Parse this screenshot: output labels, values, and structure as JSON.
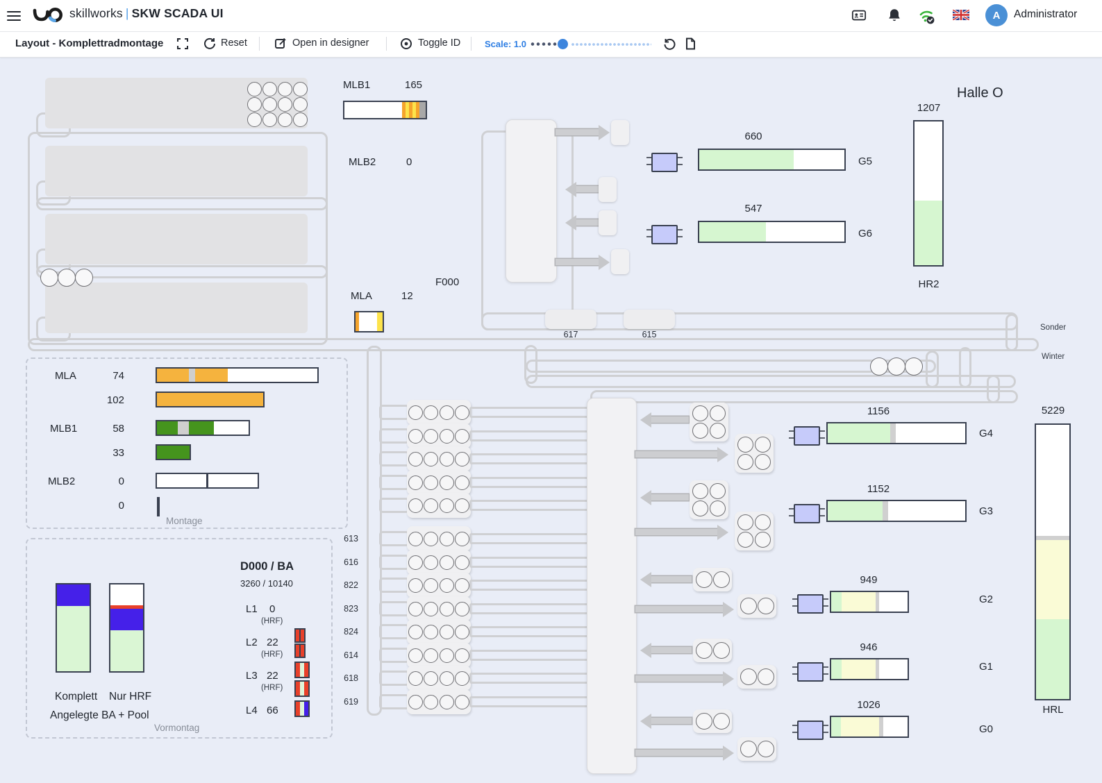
{
  "header": {
    "brand": "skillworks",
    "sep": "|",
    "app": "SKW SCADA UI",
    "user": "Administrator",
    "avatar": "A"
  },
  "toolbar": {
    "layout": "Layout - Komplettradmontage",
    "reset": "Reset",
    "designer": "Open in designer",
    "toggleid": "Toggle ID",
    "scale": "Scale: 1.0"
  },
  "colors": {
    "accent_blue": "#2e7ee3",
    "bar_border": "#394050",
    "fill_green": "#d6f6d0",
    "fill_yellow": "#fafbd6",
    "fill_orange": "#f5b33e",
    "fill_dkgreen": "#45941d",
    "fill_purple": "#4520e9",
    "fill_red": "#e8402a",
    "chip_blue": "#c6cbfa",
    "canvas_bg": "#e9edf7"
  },
  "canvas": {
    "halle": "Halle O",
    "f000": "F000",
    "sonder": "Sonder",
    "winter": "Winter",
    "st617": "617",
    "st615": "615",
    "mlb1": {
      "label": "MLB1",
      "value": "165",
      "segs": [
        [
          71,
          "#ffffff"
        ],
        [
          4.3,
          "#f5a42c"
        ],
        [
          4.3,
          "#fde34b"
        ],
        [
          4.3,
          "#f5a42c"
        ],
        [
          4.3,
          "#fde34b"
        ],
        [
          4.3,
          "#f5a42c"
        ],
        [
          7.5,
          "#a8a8a8"
        ]
      ]
    },
    "mlb2": {
      "label": "MLB2",
      "value": "0"
    },
    "mla": {
      "label": "MLA",
      "value": "12",
      "segs": [
        [
          12,
          "#f5a42c"
        ],
        [
          68,
          "#ffffff"
        ],
        [
          20,
          "#fde34b"
        ]
      ]
    },
    "g5": {
      "label": "G5",
      "value": "660",
      "segs": [
        [
          65,
          "#d6f6d0"
        ],
        [
          35,
          "#ffffff"
        ]
      ]
    },
    "g6": {
      "label": "G6",
      "value": "547",
      "segs": [
        [
          46,
          "#d6f6d0"
        ],
        [
          54,
          "#ffffff"
        ]
      ]
    },
    "g4": {
      "label": "G4",
      "value": "1156",
      "segs": [
        [
          45.5,
          "#d6f6d0"
        ],
        [
          4,
          "#d0d0d0"
        ],
        [
          50.5,
          "#ffffff"
        ]
      ]
    },
    "g3": {
      "label": "G3",
      "value": "1152",
      "segs": [
        [
          40,
          "#d6f6d0"
        ],
        [
          4,
          "#d0d0d0"
        ],
        [
          56,
          "#ffffff"
        ]
      ]
    },
    "g2": {
      "label": "G2",
      "value": "949",
      "segs": [
        [
          14,
          "#d6f6d0"
        ],
        [
          44,
          "#fafbd6"
        ],
        [
          5,
          "#d0d0d0"
        ],
        [
          37,
          "#ffffff"
        ]
      ]
    },
    "g1": {
      "label": "G1",
      "value": "946",
      "segs": [
        [
          14,
          "#d6f6d0"
        ],
        [
          44,
          "#fafbd6"
        ],
        [
          5,
          "#d0d0d0"
        ],
        [
          37,
          "#ffffff"
        ]
      ]
    },
    "g0": {
      "label": "G0",
      "value": "1026",
      "segs": [
        [
          13,
          "#d6f6d0"
        ],
        [
          50,
          "#fafbd6"
        ],
        [
          5,
          "#d0d0d0"
        ],
        [
          32,
          "#ffffff"
        ]
      ]
    },
    "hr2": {
      "label": "HR2",
      "value": "1207",
      "segs": [
        [
          55,
          "#ffffff"
        ],
        [
          45,
          "#d6f6d0"
        ]
      ]
    },
    "hrl": {
      "label": "HRL",
      "value": "5229",
      "segs": [
        [
          40.5,
          "#ffffff"
        ],
        [
          1.5,
          "#d0d0d0"
        ],
        [
          29,
          "#fafbd6"
        ],
        [
          29,
          "#d6f6d0"
        ]
      ]
    },
    "rows": [
      "",
      "",
      "",
      "",
      "",
      "613",
      "616",
      "822",
      "823",
      "824",
      "614",
      "618",
      "619"
    ]
  },
  "p1": {
    "mla_label": "MLA",
    "mla_v1": "74",
    "mla_v2": "102",
    "mla_bar1": [
      [
        20,
        "#f5b33e"
      ],
      [
        4,
        "#cfcfcf"
      ],
      [
        20,
        "#f5b33e"
      ],
      [
        56,
        "#ffffff"
      ]
    ],
    "mla_bar2": [
      [
        100,
        "#f5b33e"
      ]
    ],
    "mlb1_label": "MLB1",
    "mlb1_v1": "58",
    "mlb1_v2": "33",
    "mlb1_bar1": [
      [
        23,
        "#45941d"
      ],
      [
        12,
        "#cfcfcf"
      ],
      [
        27,
        "#45941d"
      ],
      [
        38,
        "#ffffff"
      ]
    ],
    "mlb1_bar2": [
      [
        100,
        "#45941d"
      ]
    ],
    "mlb2_label": "MLB2",
    "mlb2_v1": "0",
    "mlb2_v2": "0",
    "mlb2_bar1": [
      [
        49.3,
        "#ffffff"
      ],
      [
        1.4,
        "#394050"
      ],
      [
        49.3,
        "#ffffff"
      ]
    ],
    "caption": "Montage"
  },
  "p2": {
    "komplett_label": "Komplett",
    "komplett_segs": [
      [
        25,
        "#4520e9"
      ],
      [
        75,
        "#daf6d4"
      ]
    ],
    "nurhrf_label": "Nur HRF",
    "nurhrf_segs": [
      [
        24,
        "#ffffff"
      ],
      [
        4,
        "#e8402a"
      ],
      [
        25,
        "#4520e9"
      ],
      [
        47,
        "#daf6d4"
      ]
    ],
    "caption1": "Angelegte BA + Pool",
    "caption2": "Vormontag",
    "d000": {
      "title": "D000 / BA",
      "subtitle": "3260 / 10140",
      "l1": {
        "label": "L1",
        "value": "0",
        "sub": "(HRF)"
      },
      "l2": {
        "label": "L2",
        "value": "22",
        "sub": "(HRF)",
        "ind": [
          [
            44,
            "#e8402a"
          ],
          [
            12,
            "#394050"
          ],
          [
            44,
            "#e8402a"
          ]
        ]
      },
      "l3": {
        "label": "L3",
        "value": "22",
        "sub": "(HRF)",
        "ind": [
          [
            36,
            "#e8402a"
          ],
          [
            28,
            "#def4da"
          ],
          [
            36,
            "#e8402a"
          ]
        ]
      },
      "l4": {
        "label": "L4",
        "value": "66",
        "ind": [
          [
            33,
            "#e8402a"
          ],
          [
            34,
            "#def4da"
          ],
          [
            33,
            "#4520e9"
          ]
        ]
      }
    }
  }
}
